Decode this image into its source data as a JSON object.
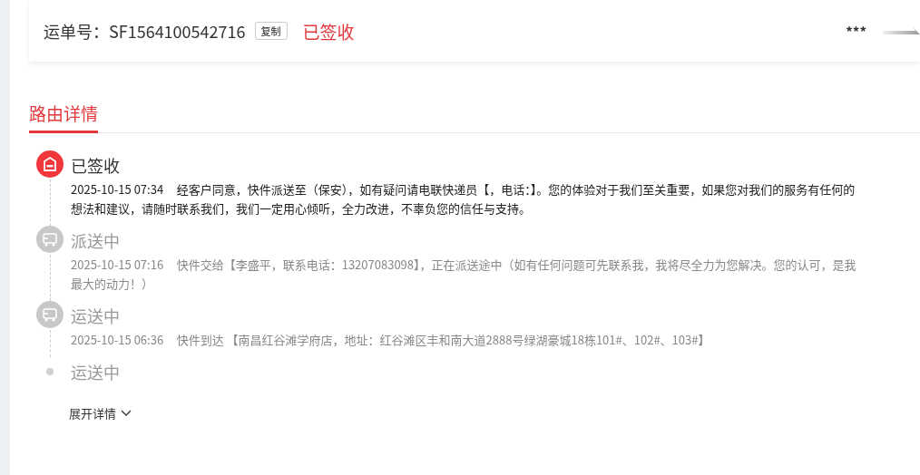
{
  "header": {
    "waybill_label": "运单号：",
    "waybill_number": "SF1564100542716",
    "copy_button": "复制",
    "status": "已签收",
    "masked_name": "***"
  },
  "tabs": [
    {
      "label": "路由详情",
      "selected": true
    }
  ],
  "route": [
    {
      "kind": "signed",
      "title": "已签收",
      "time": "2025-10-15 07:34",
      "detail": "经客户同意，快件派送至（保安），如有疑问请电联快递员【，电话：】。您的体验对于我们至关重要，如果您对我们的服务有任何的想法和建议，请随时联系我们，我们一定用心倾听，全力改进，不辜负您的信任与支持。"
    },
    {
      "kind": "vehicle",
      "title": "派送中",
      "time": "2025-10-15 07:16",
      "detail": "快件交给【李盛平，联系电话：13207083098】，正在派送途中（如有任何问题可先联系我，我将尽全力为您解决。您的认可，是我最大的动力！）"
    },
    {
      "kind": "vehicle",
      "title": "运送中",
      "time": "2025-10-15 06:36",
      "detail": "快件到达 【南昌红谷滩学府店，地址：红谷滩区丰和南大道2888号绿湖豪城18栋101#、102#、103#】"
    },
    {
      "kind": "dot",
      "title": "运送中"
    }
  ],
  "expand_link": "展开详情"
}
